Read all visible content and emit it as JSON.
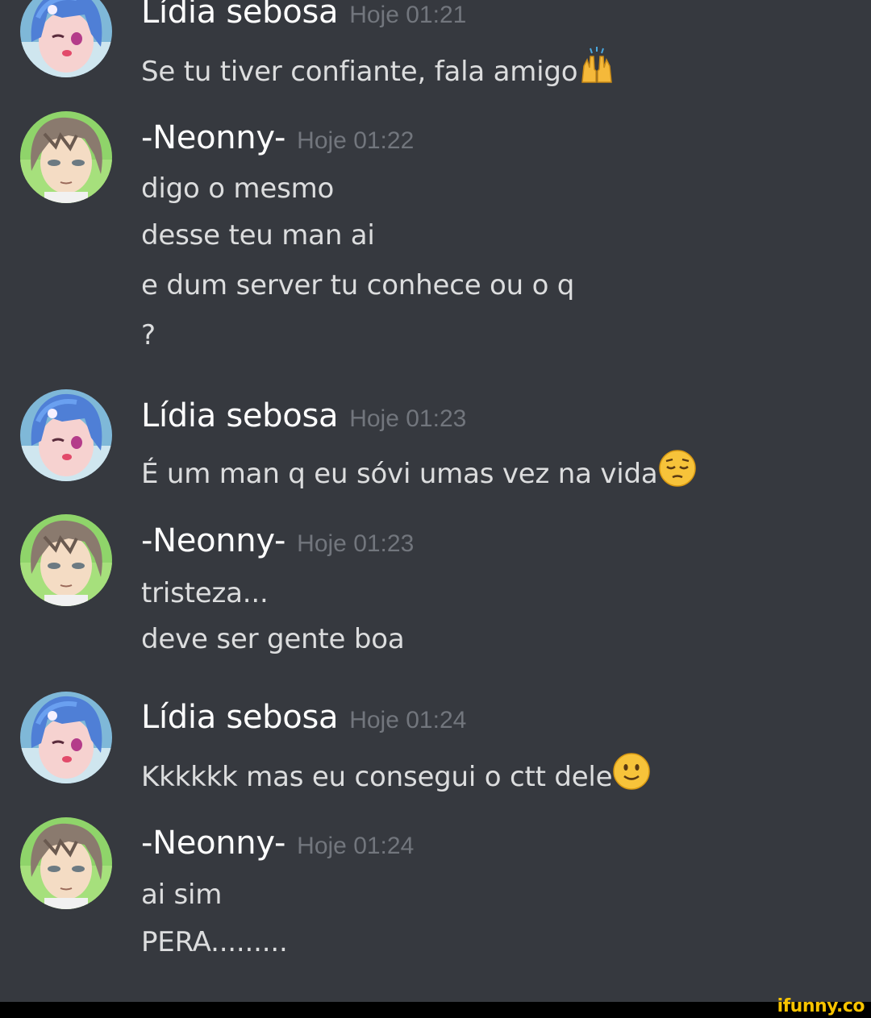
{
  "messages": [
    {
      "author": "Lídia sebosa",
      "time": "Hoje 01:21",
      "lines": [
        "Se tu tiver confiante, fala amigo"
      ],
      "line_emoji": [
        "raised-hands-emoji"
      ]
    },
    {
      "author": "-Neonny-",
      "time": "Hoje 01:22",
      "lines": [
        "digo o mesmo",
        "desse teu man ai",
        "e dum server tu conhece ou o q",
        "?"
      ]
    },
    {
      "author": "Lídia sebosa",
      "time": "Hoje 01:23",
      "lines": [
        "É um man q eu sóvi umas vez na vida"
      ],
      "line_emoji": [
        "pensive-face-emoji"
      ]
    },
    {
      "author": "-Neonny-",
      "time": "Hoje 01:23",
      "lines": [
        "tristeza...",
        "deve ser gente boa"
      ]
    },
    {
      "author": "Lídia sebosa",
      "time": "Hoje 01:24",
      "lines": [
        "Kkkkkk mas eu consegui o ctt dele"
      ],
      "line_emoji": [
        "slightly-smiling-face-emoji"
      ]
    },
    {
      "author": "-Neonny-",
      "time": "Hoje 01:24",
      "lines": [
        "ai sim",
        "PERA........."
      ]
    }
  ],
  "watermark": "ifunny.co",
  "colors": {
    "background": "#36393f",
    "username": "#ffffff",
    "timestamp": "#72767d",
    "message_text": "#dcddde",
    "watermark": "#f7c300"
  }
}
